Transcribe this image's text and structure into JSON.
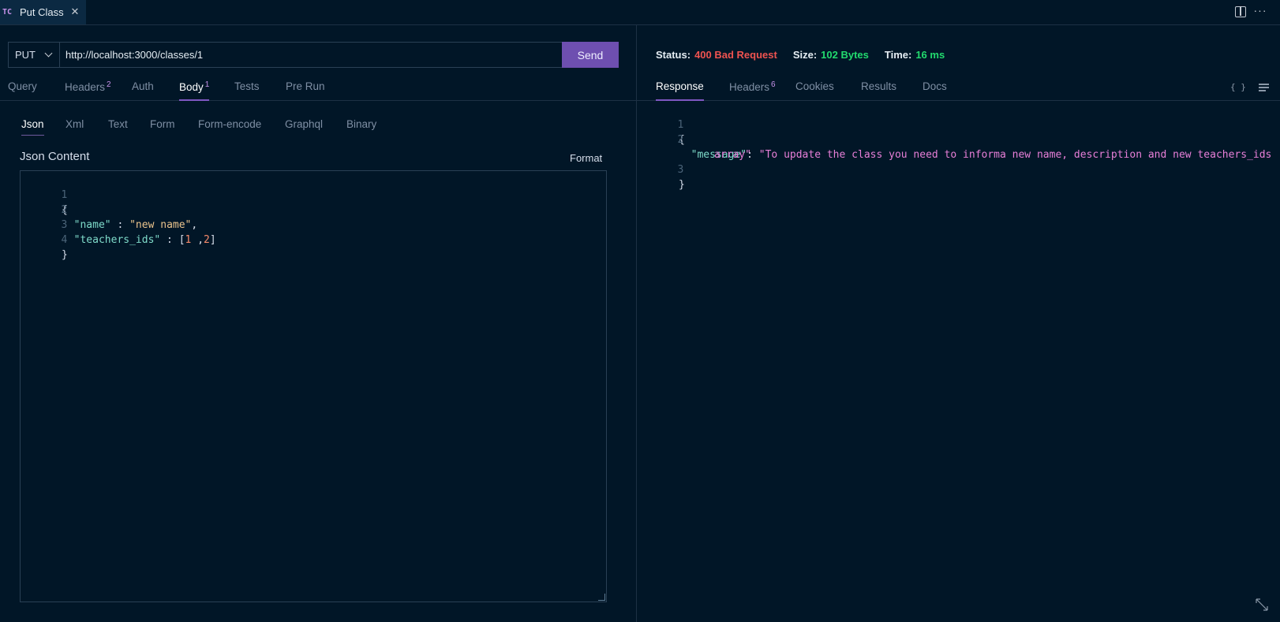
{
  "tab": {
    "badge": "TC",
    "title": "Put Class",
    "close": "✕"
  },
  "request": {
    "method": "PUT",
    "url": "http://localhost:3000/classes/1",
    "send_label": "Send",
    "tabs": [
      {
        "label": "Query",
        "badge": ""
      },
      {
        "label": "Headers",
        "badge": "2"
      },
      {
        "label": "Auth",
        "badge": ""
      },
      {
        "label": "Body",
        "badge": "1"
      },
      {
        "label": "Tests",
        "badge": ""
      },
      {
        "label": "Pre Run",
        "badge": ""
      }
    ],
    "active_tab": "Body",
    "body_tabs": [
      "Json",
      "Xml",
      "Text",
      "Form",
      "Form-encode",
      "Graphql",
      "Binary"
    ],
    "active_body_tab": "Json",
    "json_label": "Json Content",
    "format_label": "Format",
    "json_lines": [
      "{",
      "  \"name\" : \"new name\",",
      "  \"teachers_ids\" : [1 ,2]",
      "}"
    ]
  },
  "response": {
    "status_label": "Status:",
    "status_value": "400 Bad Request",
    "size_label": "Size:",
    "size_value": "102 Bytes",
    "time_label": "Time:",
    "time_value": "16 ms",
    "tabs": [
      {
        "label": "Response",
        "badge": ""
      },
      {
        "label": "Headers",
        "badge": "6"
      },
      {
        "label": "Cookies",
        "badge": ""
      },
      {
        "label": "Results",
        "badge": ""
      },
      {
        "label": "Docs",
        "badge": ""
      }
    ],
    "active_tab": "Response",
    "brace_icon": "{ }",
    "json_lines": [
      "{",
      "  \"message\": \"To update the class you need to informa new name, description and new teachers_ids",
      "array\"",
      "}"
    ],
    "line_numbers": [
      "1",
      "2",
      "",
      "3"
    ]
  },
  "colors": {
    "background": "#011627",
    "accent": "#7e57c2",
    "send_button": "#6e4fb0",
    "error": "#ef5350",
    "success": "#22da6e"
  },
  "icons": [
    "close-icon",
    "split-editor-icon",
    "more-icon",
    "chevron-down-icon",
    "brace-icon",
    "menu-icon",
    "expand-icon"
  ]
}
